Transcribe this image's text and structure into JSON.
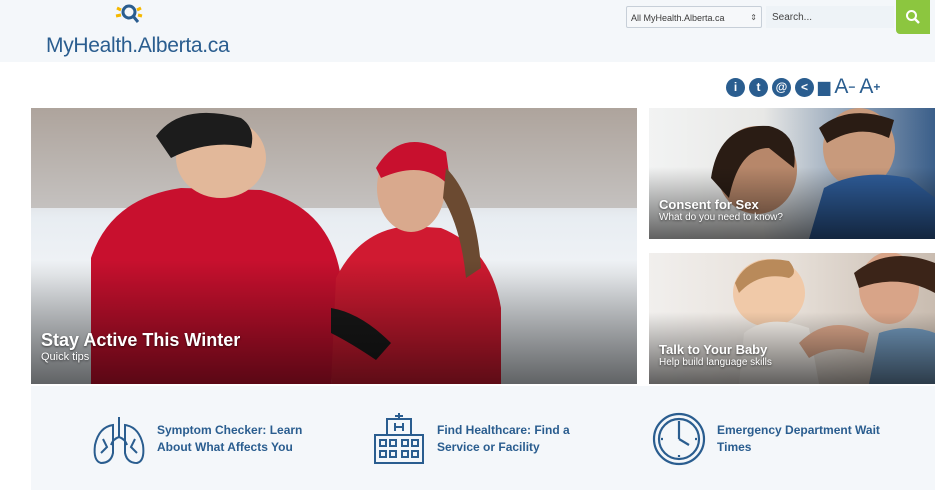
{
  "header": {
    "logo_text": "MyHealth.Alberta.ca",
    "search_scope": "All MyHealth.Alberta.ca",
    "search_placeholder": "Search..."
  },
  "tools": [
    {
      "name": "info-icon",
      "label": "i"
    },
    {
      "name": "twitter-icon",
      "label": "t"
    },
    {
      "name": "email-icon",
      "label": "@"
    },
    {
      "name": "share-icon",
      "label": "<"
    },
    {
      "name": "print-icon",
      "label": "▆"
    },
    {
      "name": "decrease-text-icon",
      "label": "A"
    },
    {
      "name": "increase-text-icon",
      "label": "A"
    }
  ],
  "hero": {
    "title": "Stay Active This Winter",
    "subtitle": "Quick tips"
  },
  "cards": [
    {
      "title": "Consent for Sex",
      "subtitle": "What do you need to know?"
    },
    {
      "title": "Talk to Your Baby",
      "subtitle": "Help build language skills"
    }
  ],
  "links": [
    {
      "text": "Symptom Checker: Learn About What Affects You",
      "icon": "lungs-icon"
    },
    {
      "text": "Find Healthcare: Find a Service or Facility",
      "icon": "hospital-icon"
    },
    {
      "text": "Emergency Department Wait Times",
      "icon": "clock-icon"
    }
  ],
  "colors": {
    "brand_blue": "#2a5d8f",
    "search_green": "#8cc63f",
    "logo_yellow": "#f5b800"
  }
}
